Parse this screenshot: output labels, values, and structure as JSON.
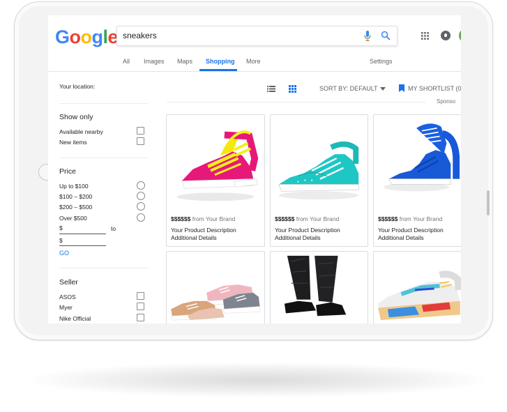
{
  "colors": {
    "accent": "#1a73e8",
    "tablet": "#f3f3f4"
  },
  "logo": {
    "text": "Google",
    "letters": [
      "G",
      "o",
      "o",
      "g",
      "l",
      "e"
    ],
    "colors": [
      "#4285f4",
      "#ea4335",
      "#fbbc05",
      "#4285f4",
      "#34a853",
      "#ea4335"
    ]
  },
  "search": {
    "query": "sneakers"
  },
  "tabs": [
    {
      "label": "All",
      "active": false
    },
    {
      "label": "Images",
      "active": false
    },
    {
      "label": "Maps",
      "active": false
    },
    {
      "label": "Shopping",
      "active": true
    },
    {
      "label": "More",
      "active": false
    },
    {
      "label": "Settings",
      "active": false
    }
  ],
  "filters": {
    "location_label": "Your location:",
    "show_only": {
      "title": "Show only",
      "items": [
        "Available nearby",
        "New items"
      ]
    },
    "price": {
      "title": "Price",
      "options": [
        "Up to $100",
        "$100 – $200",
        "$200 – $500",
        "Over $500"
      ],
      "min_prefix": "$",
      "to_label": "to",
      "max_prefix": "$",
      "go_label": "GO"
    },
    "seller": {
      "title": "Seller",
      "items": [
        "ASOS",
        "Myer",
        "Nike Official"
      ]
    }
  },
  "toolbar": {
    "sort_label": "SORT BY: DEFAULT",
    "shortlist_label": "MY SHORTLIST (0",
    "sponsored": "Sponso"
  },
  "products": [
    {
      "price": "$$$$$$",
      "source": "from Your Brand",
      "desc1": "Your Product Description",
      "desc2": "Additional Details",
      "icon": "pink-sneaker-image"
    },
    {
      "price": "$$$$$$",
      "source": "from Your Brand",
      "desc1": "Your Product Description",
      "desc2": "Additional Details",
      "icon": "teal-sneaker-image"
    },
    {
      "price": "$$$$$$",
      "source": "from Your Brand",
      "desc1": "Your Product Description",
      "desc2": "Additional Details",
      "icon": "blue-sneaker-image"
    },
    {
      "icon": "pastel-sneakers-image"
    },
    {
      "icon": "black-sneakers-on-feet-image"
    },
    {
      "icon": "white-running-shoe-image"
    }
  ]
}
